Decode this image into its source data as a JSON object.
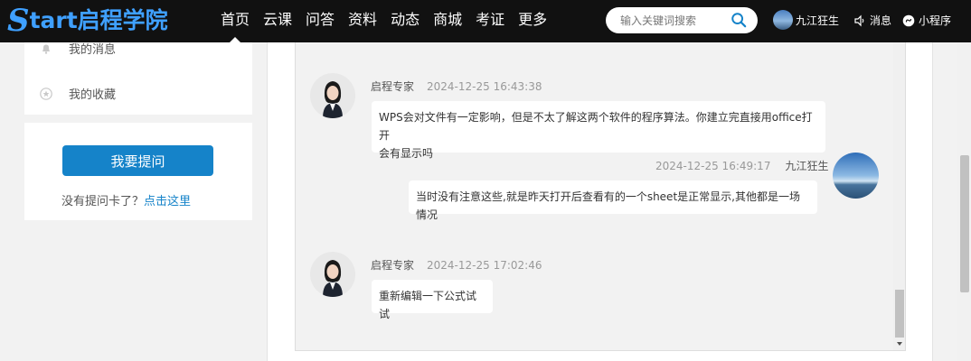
{
  "brand": {
    "logo_s": "S",
    "logo_text": "tart启程学院"
  },
  "nav": [
    {
      "label": "首页",
      "active": true
    },
    {
      "label": "云课"
    },
    {
      "label": "问答"
    },
    {
      "label": "资料"
    },
    {
      "label": "动态"
    },
    {
      "label": "商城"
    },
    {
      "label": "考证"
    },
    {
      "label": "更多"
    }
  ],
  "search": {
    "placeholder": "输入关键词搜索",
    "icon": "search-icon"
  },
  "header_user": {
    "name": "九江狂生"
  },
  "header_links": {
    "messages": "消息",
    "mini_program": "小程序"
  },
  "sidebar": {
    "items": [
      {
        "label": "我的消息",
        "icon": "bell-icon"
      },
      {
        "label": "我的收藏",
        "icon": "star-icon"
      }
    ],
    "ask_button": "我要提问",
    "hint_text": "没有提问卡了？",
    "hint_link": "点击这里"
  },
  "chat": {
    "messages": [
      {
        "sender": "启程专家",
        "time": "2024-12-25 16:43:38",
        "text_line1": "WPS会对文件有一定影响，但是不太了解这两个软件的程序算法。你建立完直接用office打开",
        "text_line2": "会有显示吗"
      },
      {
        "sender": "九江狂生",
        "time": "2024-12-25 16:49:17",
        "text": "当时没有注意这些,就是昨天打开后查看有的一个sheet是正常显示,其他都是一场情况"
      },
      {
        "sender": "启程专家",
        "time": "2024-12-25 17:02:46",
        "text": "重新编辑一下公式试试"
      }
    ]
  },
  "colors": {
    "accent": "#1583c9",
    "logo": "#3fa0ff",
    "topbar": "#111111"
  }
}
